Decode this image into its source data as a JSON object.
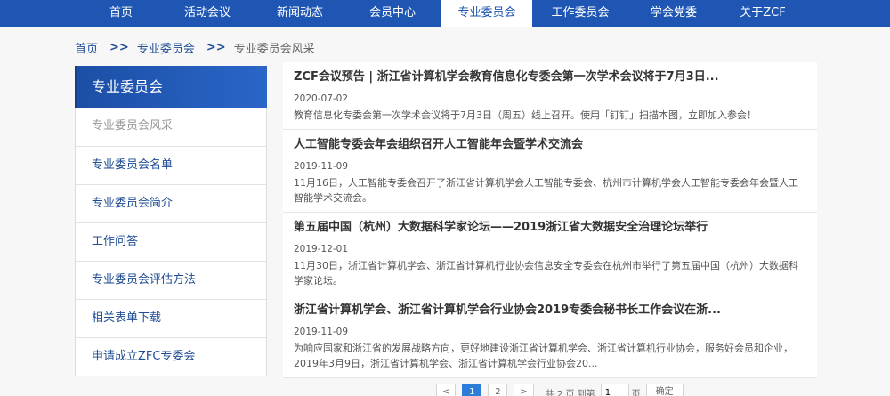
{
  "nav": {
    "items": [
      {
        "label": "首页"
      },
      {
        "label": "活动会议"
      },
      {
        "label": "新闻动态"
      },
      {
        "label": "会员中心"
      },
      {
        "label": "专业委员会",
        "active": true
      },
      {
        "label": "工作委员会"
      },
      {
        "label": "学会党委"
      },
      {
        "label": "关于ZCF"
      }
    ],
    "colors": {
      "bar": "#1f56b3",
      "active_bg": "#ffffff"
    }
  },
  "breadcrumb": {
    "home": "首页",
    "section": "专业委员会",
    "current": "专业委员会风采",
    "separator": ">>"
  },
  "sidebar": {
    "title": "专业委员会",
    "items": [
      {
        "label": "专业委员会风采"
      },
      {
        "label": "专业委员会名单"
      },
      {
        "label": "专业委员会简介"
      },
      {
        "label": "工作问答"
      },
      {
        "label": "专业委员会评估方法"
      },
      {
        "label": "相关表单下载"
      },
      {
        "label": "申请成立ZFC专委会"
      }
    ]
  },
  "articles": [
    {
      "title": "ZCF会议预告 | 浙江省计算机学会教育信息化专委会第一次学术会议将于7月3日...",
      "date": "2020-07-02",
      "summary": "教育信息化专委会第一次学术会议将于7月3日（周五）线上召开。使用「钉钉」扫描本图，立即加入参会！"
    },
    {
      "title": "人工智能专委会年会组织召开人工智能年会暨学术交流会",
      "date": "2019-11-09",
      "summary": "11月16日，人工智能专委会召开了浙江省计算机学会人工智能专委会、杭州市计算机学会人工智能专委会年会暨人工智能学术交流会。"
    },
    {
      "title": "第五届中国（杭州）大数据科学家论坛——2019浙江省大数据安全治理论坛举行",
      "date": "2019-12-01",
      "summary": "11月30日，浙江省计算机学会、浙江省计算机行业协会信息安全专委会在杭州市举行了第五届中国（杭州）大数据科学家论坛。"
    },
    {
      "title": "浙江省计算机学会、浙江省计算机学会行业协会2019专委会秘书长工作会议在浙...",
      "date": "2019-11-09",
      "summary": "为响应国家和浙江省的发展战略方向，更好地建设浙江省计算机学会、浙江省计算机行业协会，服务好会员和企业，2019年3月9日，浙江省计算机学会、浙江省计算机学会行业协会20..."
    }
  ],
  "pagination": {
    "prev": "<",
    "pages": [
      "1",
      "2"
    ],
    "current_page": "1",
    "next": ">",
    "total_text": "共 2 页 到第",
    "page_input_value": "1",
    "page_unit": "页",
    "confirm": "确定"
  }
}
